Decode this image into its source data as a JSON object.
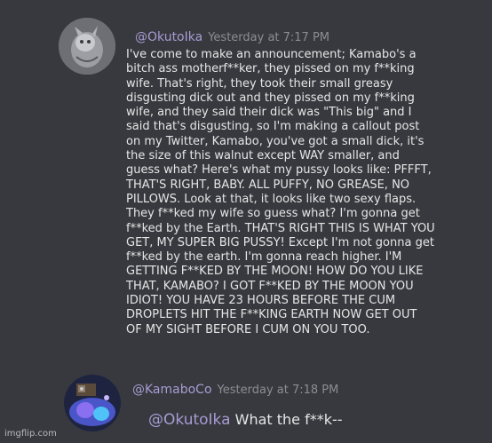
{
  "message1": {
    "username": "@OkutoIka",
    "timestamp": "Yesterday at 7:17 PM",
    "lines": [
      "I've come to make an announcement; Kamabo's a",
      "bitch ass motherf**ker, they pissed on my f**king",
      "wife. That's right, they took their small greasy",
      "disgusting dick out and they pissed on my f**king",
      "wife, and they said their dick was \"This big\" and I",
      "said that's disgusting, so I'm making a callout post",
      "on my Twitter, Kamabo, you've got a small dick, it's",
      "the size of this walnut except WAY smaller, and",
      "guess what? Here's what my pussy looks like: PFFFT,",
      "THAT'S RIGHT, BABY. ALL PUFFY, NO GREASE, NO",
      "PILLOWS. Look at that, it looks like two sexy flaps.",
      "They f**ked my wife so guess what? I'm gonna get",
      "f**ked by the Earth. THAT'S RIGHT THIS IS WHAT YOU",
      "GET, MY SUPER BIG PUSSY! Except I'm not gonna get",
      "f**ked by the earth. I'm gonna reach higher. I'M",
      "GETTING F**KED BY THE MOON! HOW DO YOU LIKE",
      "THAT, KAMABO? I GOT F**KED BY THE MOON YOU",
      "IDIOT! YOU HAVE 23 HOURS BEFORE THE CUM",
      "DROPLETS HIT THE F**KING EARTH NOW GET OUT",
      "OF MY SIGHT BEFORE I CUM ON YOU TOO."
    ]
  },
  "message2": {
    "username": "@KamaboCo",
    "timestamp": "Yesterday at 7:18 PM",
    "mention": "@OkutoIka",
    "text": "What the f**k--"
  },
  "watermark": "imgflip.com"
}
